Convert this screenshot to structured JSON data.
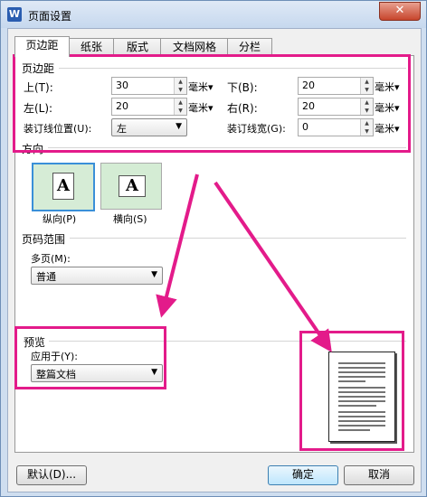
{
  "window": {
    "title": "页面设置",
    "app_icon": "W"
  },
  "tabs": [
    "页边距",
    "纸张",
    "版式",
    "文档网格",
    "分栏"
  ],
  "margins": {
    "group_label": "页边距",
    "top": {
      "label": "上(T):",
      "value": "30",
      "unit": "毫米"
    },
    "bottom": {
      "label": "下(B):",
      "value": "20",
      "unit": "毫米"
    },
    "left": {
      "label": "左(L):",
      "value": "20",
      "unit": "毫米"
    },
    "right": {
      "label": "右(R):",
      "value": "20",
      "unit": "毫米"
    },
    "gutter_pos": {
      "label": "装订线位置(U):",
      "value": "左"
    },
    "gutter_width": {
      "label": "装订线宽(G):",
      "value": "0",
      "unit": "毫米"
    }
  },
  "orientation": {
    "group_label": "方向",
    "portrait": {
      "label": "纵向(P)",
      "glyph": "A"
    },
    "landscape": {
      "label": "横向(S)",
      "glyph": "A"
    }
  },
  "page_range": {
    "group_label": "页码范围",
    "multi_label": "多页(M):",
    "multi_value": "普通"
  },
  "preview": {
    "group_label": "预览",
    "apply_label": "应用于(Y):",
    "apply_value": "整篇文档"
  },
  "buttons": {
    "default": "默认(D)...",
    "ok": "确定",
    "cancel": "取消"
  },
  "annotation_color": "#e31b8a"
}
